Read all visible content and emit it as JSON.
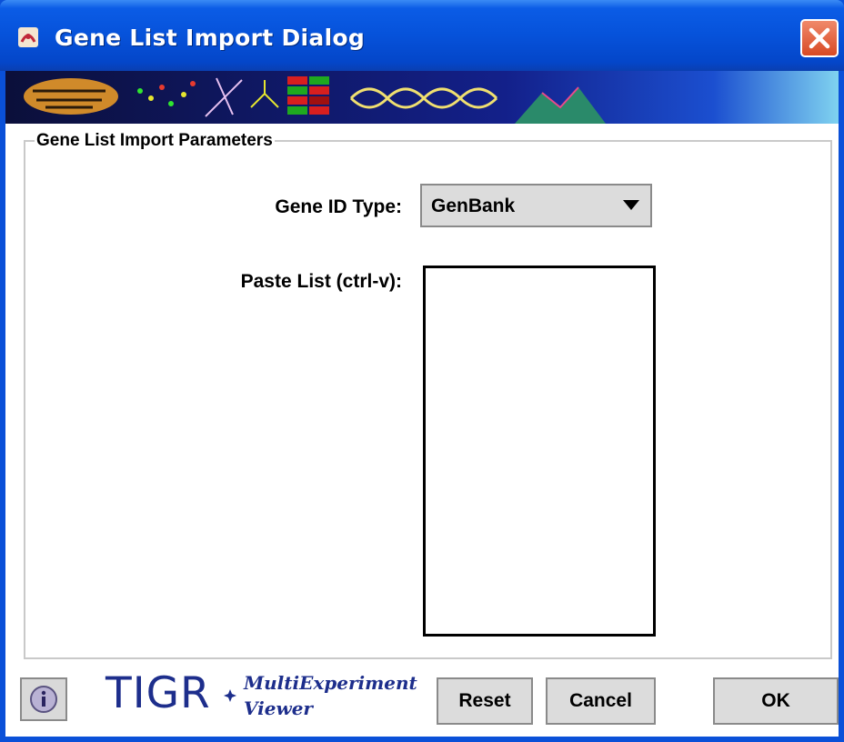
{
  "window": {
    "title": "Gene List Import Dialog",
    "icons": {
      "app": "tigr-app-icon",
      "close": "close-icon"
    }
  },
  "params": {
    "group_title": "Gene List Import Parameters",
    "gene_id_label": "Gene ID Type:",
    "gene_id_selected": "GenBank",
    "paste_label": "Paste List (ctrl-v):",
    "paste_value": ""
  },
  "footer": {
    "logo_main": "TIGR",
    "logo_sub1": "MultiExperiment",
    "logo_sub2": "Viewer",
    "reset_label": "Reset",
    "cancel_label": "Cancel",
    "ok_label": "OK",
    "info_icon": "info-icon"
  },
  "colors": {
    "titlebar": "#0652da",
    "close": "#d84a24",
    "logo": "#1d2e8c",
    "button_face": "#dcdcdc"
  }
}
